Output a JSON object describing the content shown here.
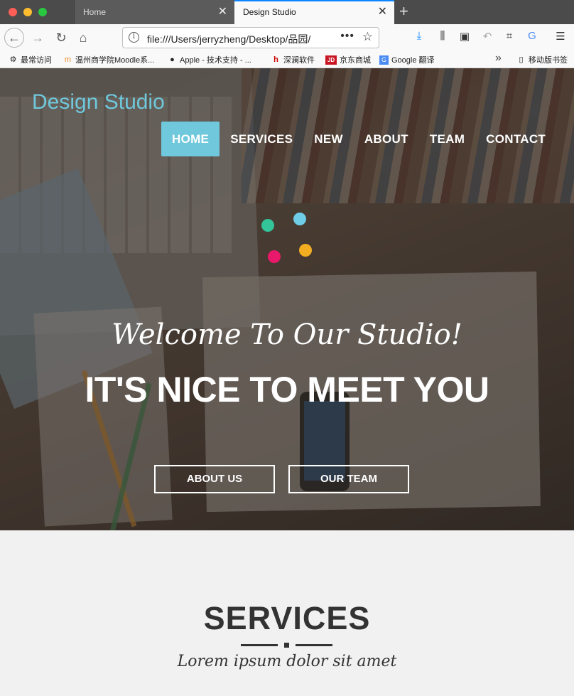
{
  "browser": {
    "tabs": [
      {
        "label": "Home",
        "active": false
      },
      {
        "label": "Design Studio",
        "active": true
      }
    ],
    "url": "file:///Users/jerryzheng/Desktop/品园/",
    "bookmarks": [
      {
        "label": "最常访问",
        "icon": "gear-icon"
      },
      {
        "label": "温州商学院Moodle系...",
        "icon": "moodle-icon"
      },
      {
        "label": "Apple - 技术支持 - ...",
        "icon": "apple-icon"
      },
      {
        "label": "深澜软件",
        "icon": "srun-icon"
      },
      {
        "label": "京东商城",
        "icon": "jd-icon"
      },
      {
        "label": "Google 翻译",
        "icon": "google-translate-icon"
      },
      {
        "label": "移动版书签",
        "icon": "mobile-icon"
      }
    ]
  },
  "site": {
    "brand": "Design Studio",
    "menu": [
      {
        "label": "HOME",
        "active": true
      },
      {
        "label": "SERVICES",
        "active": false
      },
      {
        "label": "NEW",
        "active": false
      },
      {
        "label": "ABOUT",
        "active": false
      },
      {
        "label": "TEAM",
        "active": false
      },
      {
        "label": "CONTACT",
        "active": false
      }
    ],
    "accent": "#6fc8dc",
    "dots": [
      "#34c49a",
      "#6fcde8",
      "#e8196a",
      "#f2ae20"
    ],
    "hero": {
      "welcome": "Welcome To Our Studio!",
      "headline": "IT'S NICE TO MEET YOU",
      "buttons": [
        "ABOUT US",
        "OUR TEAM"
      ]
    },
    "services": {
      "title": "SERVICES",
      "subtitle": "Lorem ipsum dolor sit amet"
    }
  }
}
